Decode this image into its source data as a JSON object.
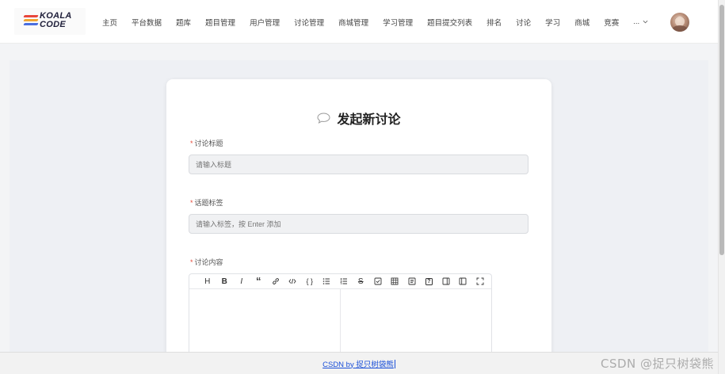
{
  "logo": {
    "line1": "KOALA",
    "line2": "CODE",
    "stripe_colors": [
      "#e8463c",
      "#f2a531",
      "#4a6ee0"
    ]
  },
  "nav": {
    "items": [
      "主页",
      "平台数据",
      "题库",
      "题目管理",
      "用户管理",
      "讨论管理",
      "商城管理",
      "学习管理",
      "题目提交列表",
      "排名",
      "讨论",
      "学习",
      "商城",
      "竞赛"
    ],
    "more": "...",
    "more_icon": "chevron-down-icon"
  },
  "page": {
    "title": "发起新讨论",
    "title_icon": "speech-bubble-icon"
  },
  "form": {
    "title_field": {
      "label": "讨论标题",
      "placeholder": "请输入标题"
    },
    "tags_field": {
      "label": "话题标签",
      "placeholder": "请输入标签，按 Enter 添加"
    },
    "content_field": {
      "label": "讨论内容"
    }
  },
  "editor": {
    "tools": [
      {
        "name": "heading-tool",
        "glyph": "H"
      },
      {
        "name": "bold-tool",
        "glyph": "B"
      },
      {
        "name": "italic-tool",
        "glyph": "I"
      },
      {
        "name": "quote-tool",
        "glyph": "“"
      },
      {
        "name": "link-tool",
        "glyph": ""
      },
      {
        "name": "code-tool",
        "glyph": ""
      },
      {
        "name": "code-block-tool",
        "glyph": "{ }"
      },
      {
        "name": "unordered-list-tool",
        "glyph": ""
      },
      {
        "name": "ordered-list-tool",
        "glyph": ""
      },
      {
        "name": "strikethrough-tool",
        "glyph": "S"
      },
      {
        "name": "task-list-tool",
        "glyph": ""
      },
      {
        "name": "table-tool",
        "glyph": ""
      },
      {
        "name": "toc-tool",
        "glyph": ""
      },
      {
        "name": "help-tool",
        "glyph": "?"
      },
      {
        "name": "preview-tool",
        "glyph": ""
      },
      {
        "name": "edit-only-tool",
        "glyph": ""
      },
      {
        "name": "fullscreen-tool",
        "glyph": ""
      }
    ]
  },
  "footer": {
    "link_text": "CSDN by 捉只树袋熊"
  },
  "watermark": "CSDN @捉只树袋熊",
  "colors": {
    "required": "#e74c3c",
    "link": "#1a4fd8"
  }
}
